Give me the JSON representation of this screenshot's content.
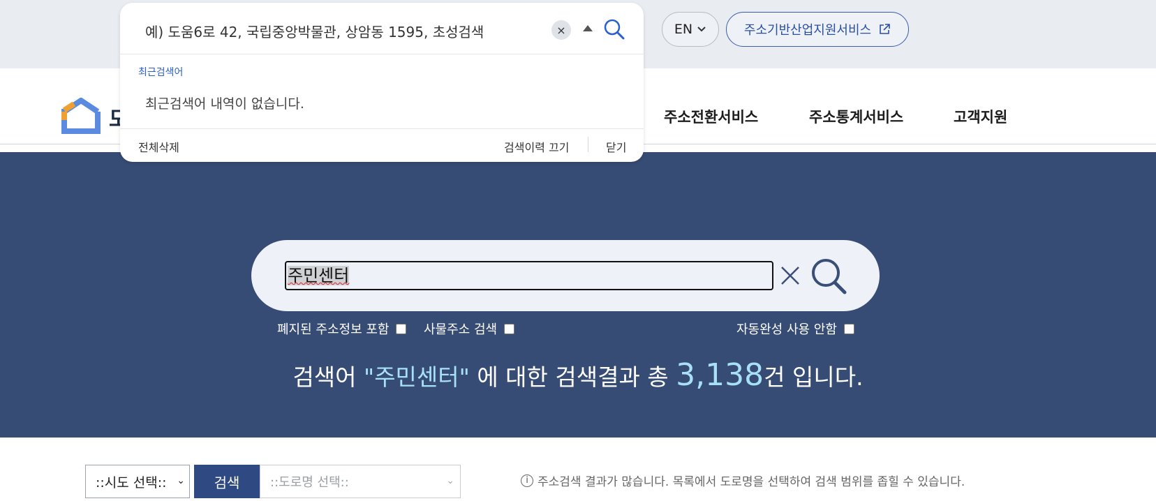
{
  "header": {
    "lang_label": "EN",
    "ext_service_label": "주소기반산업지원서비스"
  },
  "logo": {
    "partial_text": "도"
  },
  "nav": {
    "items": [
      {
        "label": "주소전환서비스"
      },
      {
        "label": "주소통계서비스"
      },
      {
        "label": "고객지원"
      }
    ]
  },
  "dropdown": {
    "placeholder": "예) 도움6로 42, 국립중앙박물관, 상암동 1595, 초성검색",
    "clear_symbol": "×",
    "recent_title": "최근검색어",
    "empty_message": "최근검색어 내역이 없습니다.",
    "delete_all_label": "전체삭제",
    "history_off_label": "검색이력 끄기",
    "close_label": "닫기"
  },
  "search": {
    "query": "주민센터",
    "options": {
      "include_abolished": {
        "label": "폐지된 주소정보 포함",
        "checked": false
      },
      "thing_address": {
        "label": "사물주소 검색",
        "checked": false
      },
      "disable_autocomplete": {
        "label": "자동완성 사용 안함",
        "checked": false
      }
    }
  },
  "result": {
    "prefix": "검색어 ",
    "query_quoted": "\"주민센터\"",
    "middle": " 에 대한 검색결과 총 ",
    "count": "3,138",
    "suffix": "건 입니다."
  },
  "filters": {
    "sido_select": "::시도 선택::",
    "search_button": "검색",
    "road_select": "::도로명 선택::",
    "hint": "주소검색 결과가 많습니다. 목록에서 도로명을 선택하여 검색 범위를 좁힐 수 있습니다."
  },
  "colors": {
    "hero_bg": "#374c74",
    "accent_blue": "#2a4fa8",
    "result_highlight": "#a8e1f7",
    "logo_blue": "#5b8be0",
    "logo_orange": "#f0a030"
  }
}
